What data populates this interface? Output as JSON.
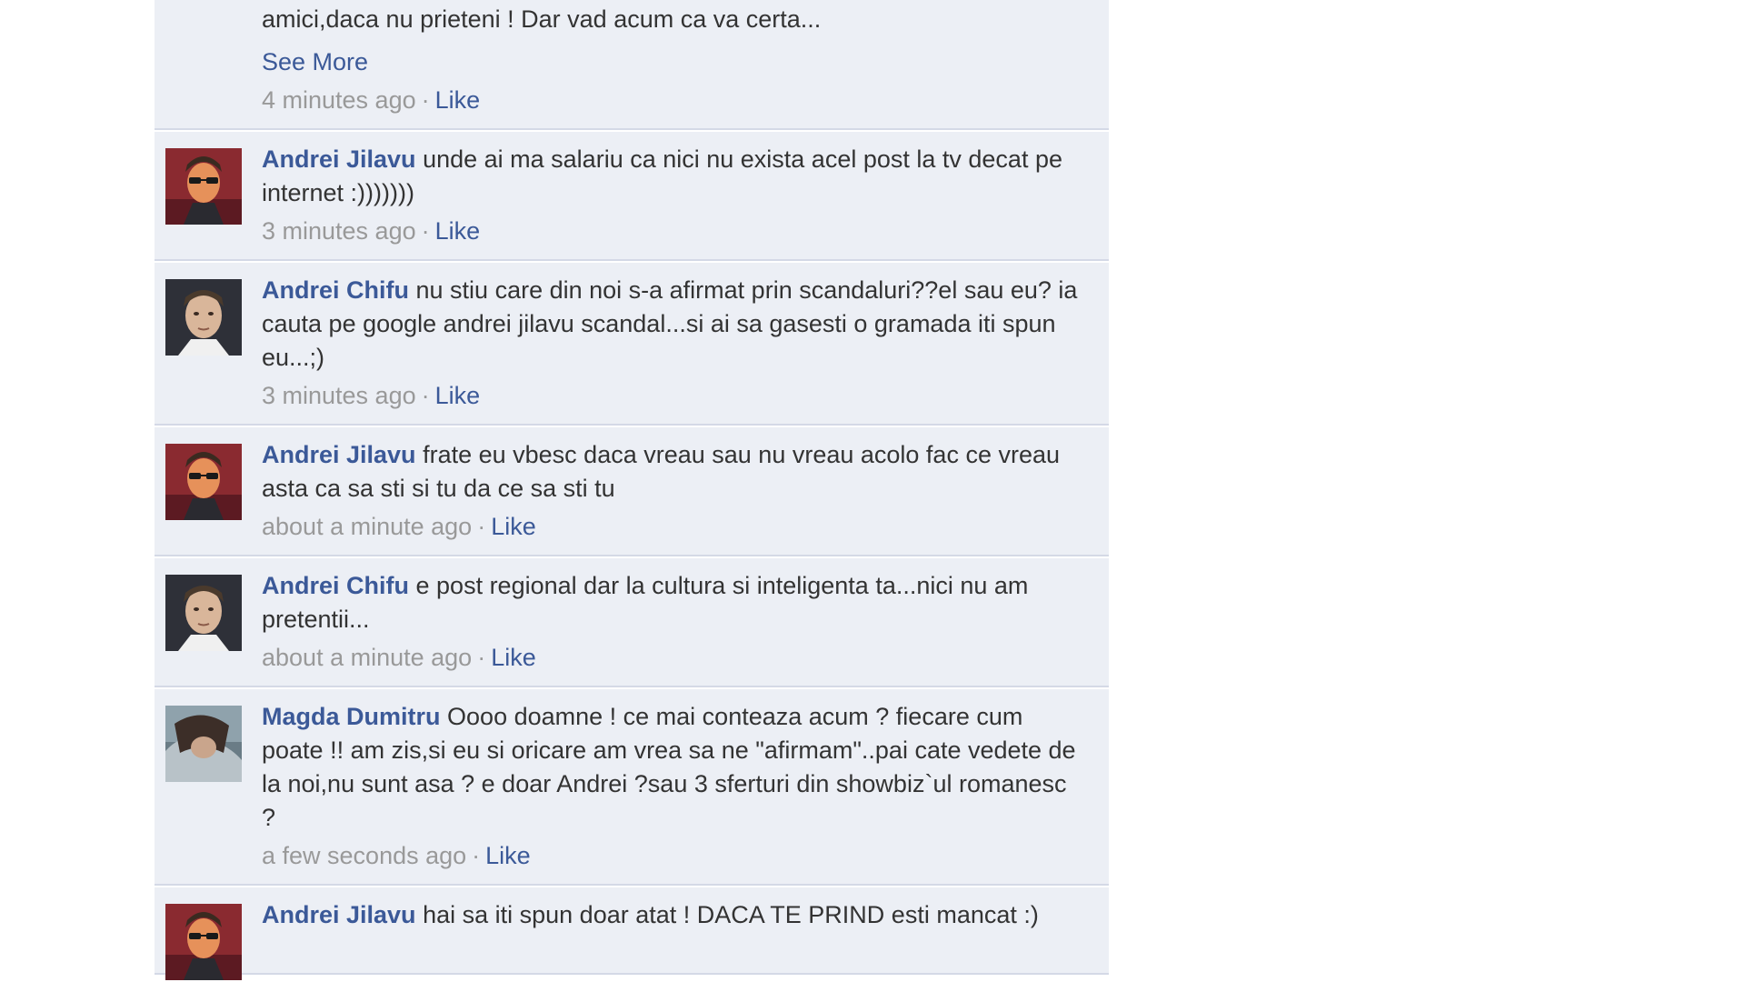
{
  "comments": [
    {
      "id": "c0",
      "author": "",
      "text": "doar ca ma amuz putin..am crezut ca v`ati revenit si ca sunteti macar amici,daca nu prieteni ! Dar vad acum ca va certa...",
      "see_more": "See More",
      "time": "4 minutes ago",
      "like": "Like",
      "avatar": "none"
    },
    {
      "id": "c1",
      "author": "Andrei Jilavu",
      "text": "unde ai ma salariu ca nici nu exista acel post la tv decat pe internet :)))))))",
      "time": "3 minutes ago",
      "like": "Like",
      "avatar": "jilavu"
    },
    {
      "id": "c2",
      "author": "Andrei Chifu",
      "text": "nu stiu care din noi s-a afirmat prin scandaluri??el sau eu? ia cauta pe google andrei jilavu scandal...si ai sa gasesti o gramada iti spun eu...;)",
      "time": "3 minutes ago",
      "like": "Like",
      "avatar": "chifu"
    },
    {
      "id": "c3",
      "author": "Andrei Jilavu",
      "text": "frate eu vbesc daca vreau sau nu vreau acolo fac ce vreau asta ca sa sti si tu da ce sa sti tu",
      "time": "about a minute ago",
      "like": "Like",
      "avatar": "jilavu"
    },
    {
      "id": "c4",
      "author": "Andrei Chifu",
      "text": "e post regional dar la cultura si inteligenta ta...nici nu am pretentii...",
      "time": "about a minute ago",
      "like": "Like",
      "avatar": "chifu"
    },
    {
      "id": "c5",
      "author": "Magda Dumitru",
      "text": "Oooo doamne ! ce mai conteaza acum ? fiecare cum poate !! am zis,si eu si oricare am vrea sa ne \"afirmam\"..pai cate vedete de la noi,nu sunt asa ? e doar Andrei ?sau 3 sferturi din showbiz`ul romanesc ?",
      "time": "a few seconds ago",
      "like": "Like",
      "avatar": "magda"
    },
    {
      "id": "c6",
      "author": "Andrei Jilavu",
      "text": "hai sa iti spun doar atat ! DACA TE PRIND esti mancat :)",
      "time": "",
      "like": "",
      "avatar": "jilavu"
    }
  ],
  "separator": "·",
  "colors": {
    "background": "#eceff5",
    "link": "#3b5998",
    "text": "#333333",
    "meta": "#999999",
    "divider": "#d4d9e6"
  }
}
